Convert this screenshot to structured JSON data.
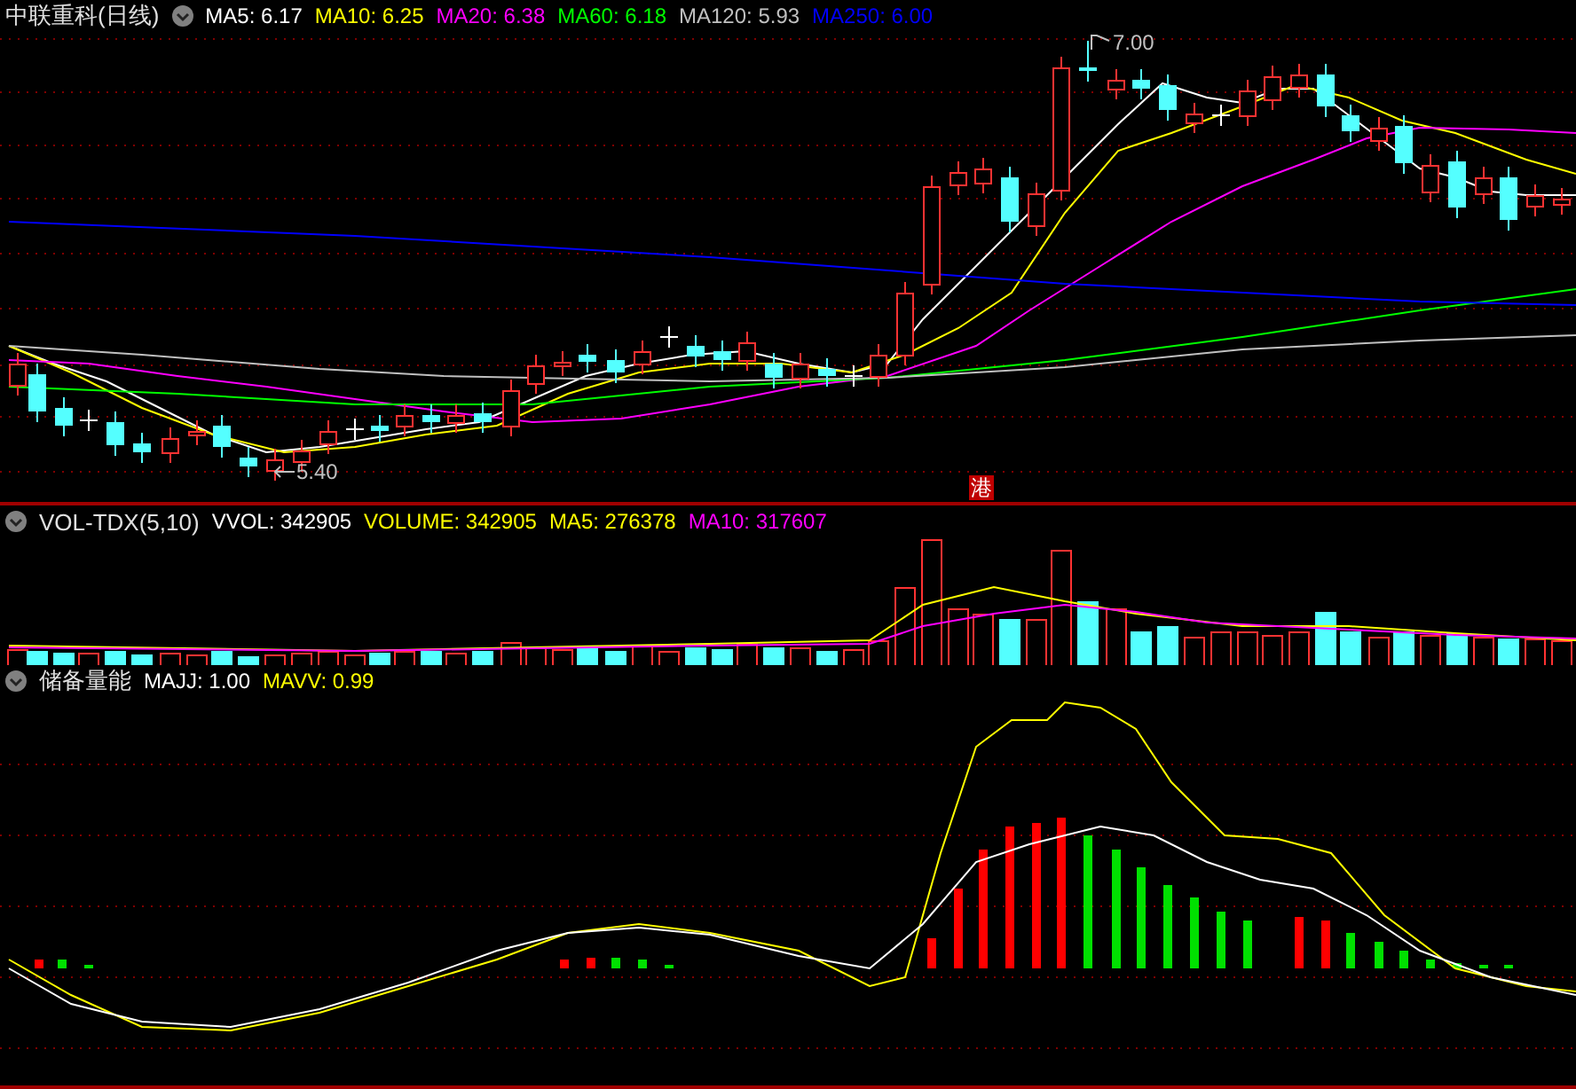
{
  "price_panel": {
    "title": "中联重科(日线)",
    "indicators": [
      {
        "label": "MA5: 6.17",
        "color": "#ffffff"
      },
      {
        "label": "MA10: 6.25",
        "color": "#ffff00"
      },
      {
        "label": "MA20: 6.38",
        "color": "#ff00ff"
      },
      {
        "label": "MA60: 6.18",
        "color": "#00ff00"
      },
      {
        "label": "MA120: 5.93",
        "color": "#c0c0c0"
      },
      {
        "label": "MA250: 6.00",
        "color": "#0000ff"
      }
    ],
    "high_marker": "7.00",
    "low_marker": "5.40",
    "badge": "港"
  },
  "volume_panel": {
    "title": "VOL-TDX(5,10)",
    "indicators": [
      {
        "label": "VVOL: 342905",
        "color": "#ffffff"
      },
      {
        "label": "VOLUME: 342905",
        "color": "#ffff00"
      },
      {
        "label": "MA5: 276378",
        "color": "#ffff00"
      },
      {
        "label": "MA10: 317607",
        "color": "#ff00ff"
      }
    ]
  },
  "energy_panel": {
    "title": "储备量能",
    "indicators": [
      {
        "label": "MAJJ: 1.00",
        "color": "#ffffff"
      },
      {
        "label": "MAVV: 0.99",
        "color": "#ffff00"
      }
    ]
  }
}
